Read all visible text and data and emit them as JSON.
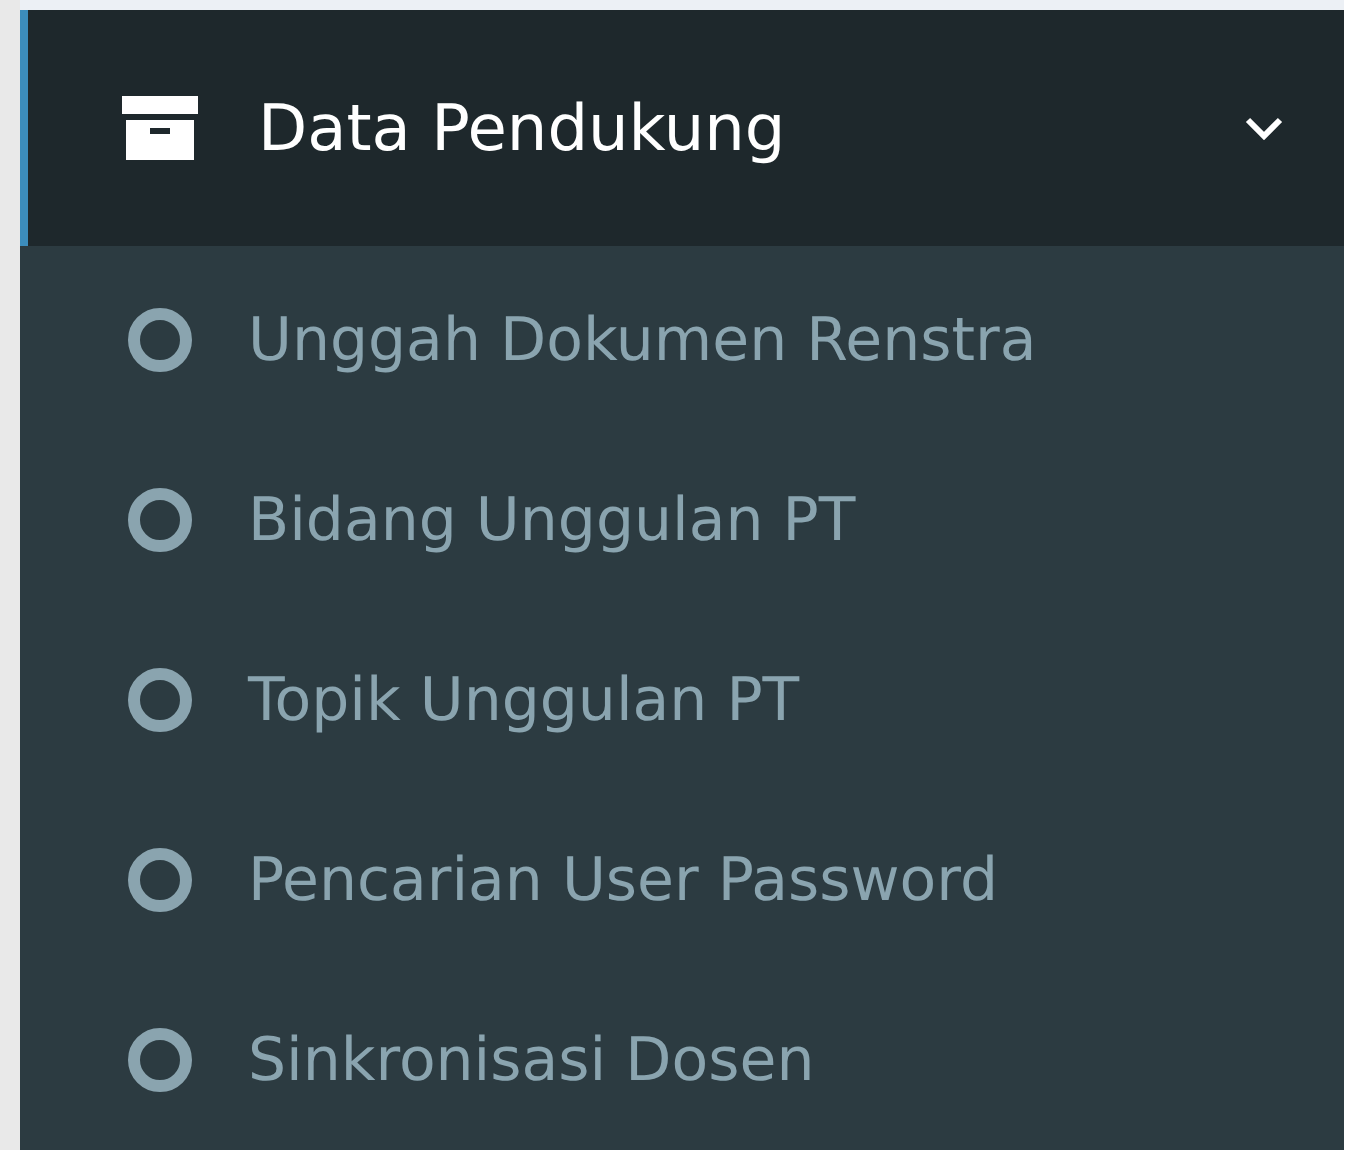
{
  "menu": {
    "label": "Data Pendukung",
    "expanded": true,
    "items": [
      {
        "label": "Unggah Dokumen Renstra",
        "selected": false
      },
      {
        "label": "Bidang Unggulan PT",
        "selected": false
      },
      {
        "label": "Topik Unggulan PT",
        "selected": false
      },
      {
        "label": "Pencarian User Password",
        "selected": false
      },
      {
        "label": "Sinkronisasi Dosen",
        "selected": false
      }
    ]
  }
}
